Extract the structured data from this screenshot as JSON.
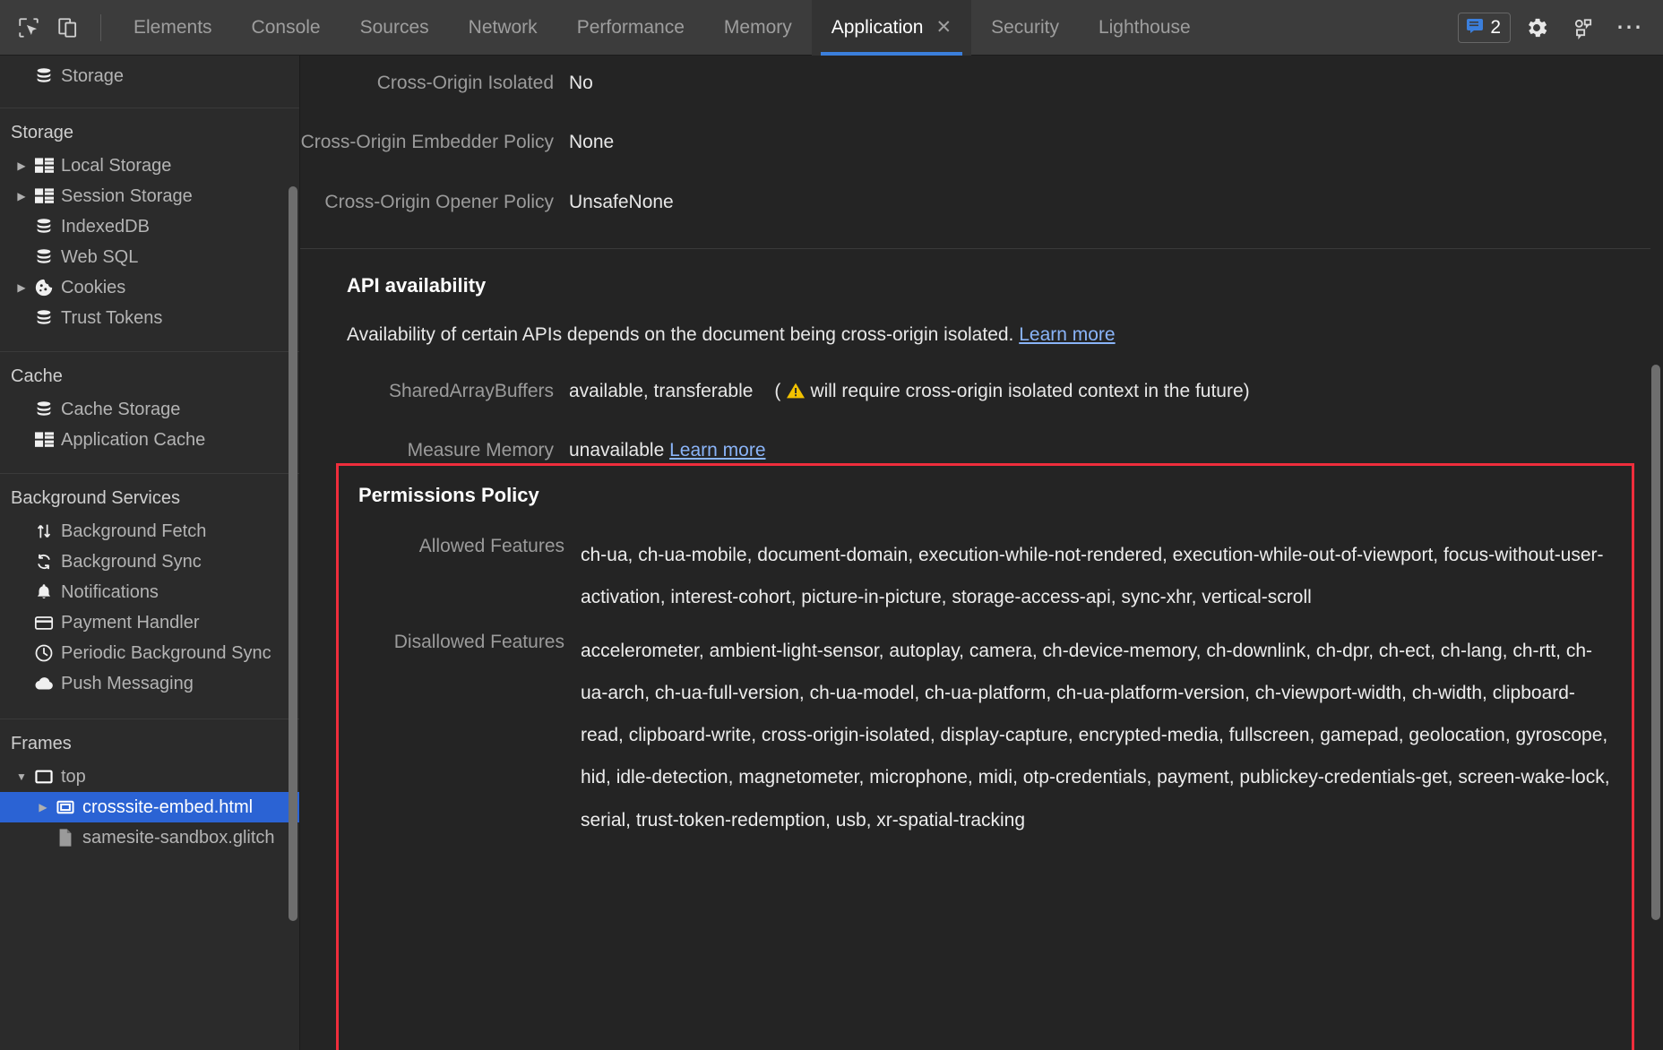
{
  "toolbar": {
    "inspect_icon": "inspect-element-icon",
    "device_icon": "device-toolbar-icon",
    "tabs": [
      {
        "label": "Elements",
        "active": false
      },
      {
        "label": "Console",
        "active": false
      },
      {
        "label": "Sources",
        "active": false
      },
      {
        "label": "Network",
        "active": false
      },
      {
        "label": "Performance",
        "active": false
      },
      {
        "label": "Memory",
        "active": false
      },
      {
        "label": "Application",
        "active": true,
        "closable": true
      },
      {
        "label": "Security",
        "active": false
      },
      {
        "label": "Lighthouse",
        "active": false
      }
    ],
    "close_glyph": "✕",
    "message_count": "2",
    "settings_icon": "gear-icon",
    "devices_icon": "devices-icon",
    "more_icon": "⋯",
    "accent_color": "#3b7fdc",
    "active_tab_bg": "#333333"
  },
  "sidebar": {
    "top_partial_item": {
      "label": "Storage",
      "icon": "database-icon"
    },
    "sections": [
      {
        "title": "Storage",
        "items": [
          {
            "label": "Local Storage",
            "icon": "table-icon",
            "expandable": true
          },
          {
            "label": "Session Storage",
            "icon": "table-icon",
            "expandable": true
          },
          {
            "label": "IndexedDB",
            "icon": "database-icon",
            "expandable": false
          },
          {
            "label": "Web SQL",
            "icon": "database-icon",
            "expandable": false
          },
          {
            "label": "Cookies",
            "icon": "cookie-icon",
            "expandable": true
          },
          {
            "label": "Trust Tokens",
            "icon": "database-icon",
            "expandable": false
          }
        ]
      },
      {
        "title": "Cache",
        "items": [
          {
            "label": "Cache Storage",
            "icon": "database-icon",
            "expandable": false
          },
          {
            "label": "Application Cache",
            "icon": "table-icon",
            "expandable": false
          }
        ]
      },
      {
        "title": "Background Services",
        "items": [
          {
            "label": "Background Fetch",
            "icon": "updown-arrows-icon",
            "expandable": false
          },
          {
            "label": "Background Sync",
            "icon": "sync-icon",
            "expandable": false
          },
          {
            "label": "Notifications",
            "icon": "bell-icon",
            "expandable": false
          },
          {
            "label": "Payment Handler",
            "icon": "credit-card-icon",
            "expandable": false
          },
          {
            "label": "Periodic Background Sync",
            "icon": "clock-icon",
            "expandable": false
          },
          {
            "label": "Push Messaging",
            "icon": "cloud-icon",
            "expandable": false
          }
        ]
      },
      {
        "title": "Frames",
        "items": [
          {
            "label": "top",
            "icon": "frame-icon",
            "expandable": true,
            "expanded": true,
            "indent": 0
          },
          {
            "label": "crosssite-embed.html",
            "icon": "frame-icon",
            "expandable": true,
            "expanded": false,
            "indent": 1,
            "selected": true
          },
          {
            "label": "samesite-sandbox.glitch",
            "icon": "document-icon",
            "expandable": false,
            "indent": 1
          }
        ]
      }
    ],
    "selected_color": "#2b63d4"
  },
  "main": {
    "security_rows": [
      {
        "key": "Cross-Origin Isolated",
        "value": "No"
      },
      {
        "key": "Cross-Origin Embedder Policy",
        "value": "None"
      },
      {
        "key": "Cross-Origin Opener Policy",
        "value": "UnsafeNone"
      }
    ],
    "api_availability": {
      "title": "API availability",
      "description_prefix": "Availability of certain APIs depends on the document being cross-origin isolated. ",
      "description_link": "Learn more",
      "rows": [
        {
          "key": "SharedArrayBuffers",
          "value": "available, transferable",
          "note_prefix": "(",
          "warning_icon": "warning-triangle-icon",
          "note": " will require cross-origin isolated context in the future)"
        },
        {
          "key": "Measure Memory",
          "value": "unavailable",
          "link": "Learn more"
        }
      ]
    },
    "permissions_policy": {
      "title": "Permissions Policy",
      "highlight_color": "#ef2d3c",
      "rows": [
        {
          "key": "Allowed Features",
          "value": "ch-ua, ch-ua-mobile, document-domain, execution-while-not-rendered, execution-while-out-of-viewport, focus-without-user-activation, interest-cohort, picture-in-picture, storage-access-api, sync-xhr, vertical-scroll"
        },
        {
          "key": "Disallowed Features",
          "value": "accelerometer, ambient-light-sensor, autoplay, camera, ch-device-memory, ch-downlink, ch-dpr, ch-ect, ch-lang, ch-rtt, ch-ua-arch, ch-ua-full-version, ch-ua-model, ch-ua-platform, ch-ua-platform-version, ch-viewport-width, ch-width, clipboard-read, clipboard-write, cross-origin-isolated, display-capture, encrypted-media, fullscreen, gamepad, geolocation, gyroscope, hid, idle-detection, magnetometer, microphone, midi, otp-credentials, payment, publickey-credentials-get, screen-wake-lock, serial, trust-token-redemption, usb, xr-spatial-tracking"
        }
      ]
    }
  }
}
